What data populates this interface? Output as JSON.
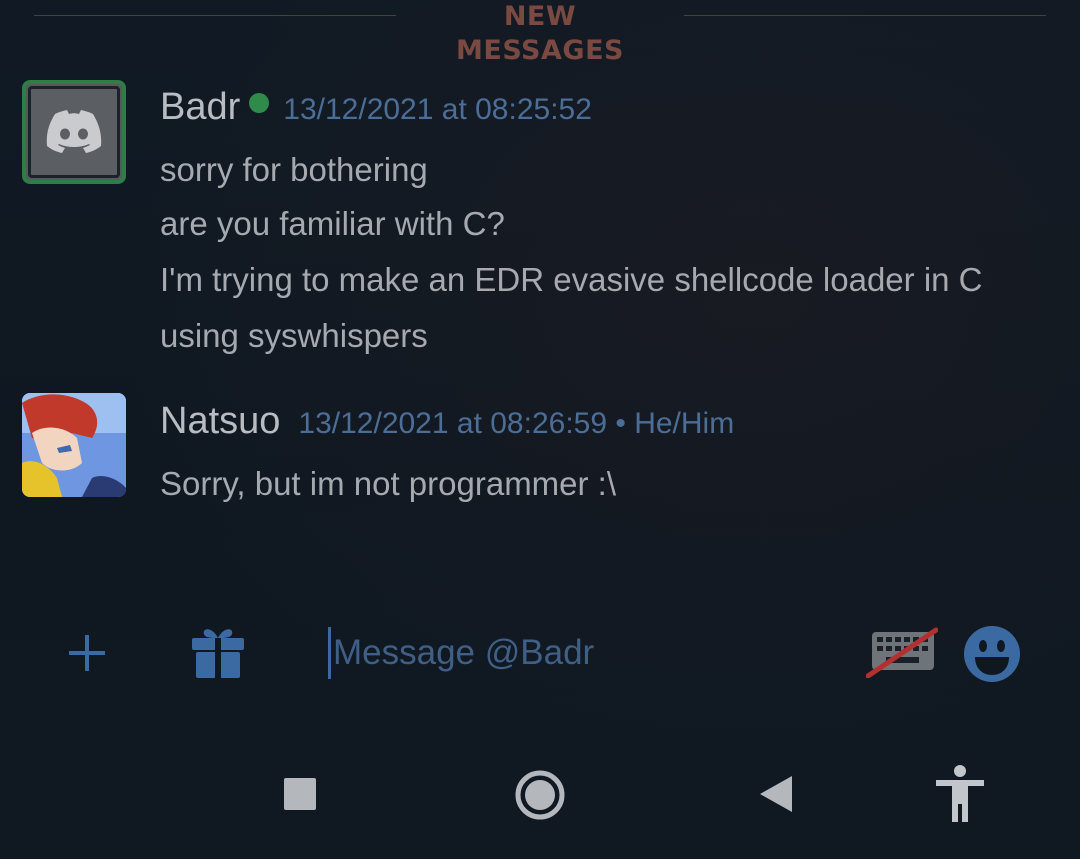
{
  "divider": {
    "label": "NEW MESSAGES"
  },
  "messages": [
    {
      "username": "Badr",
      "timestamp": "13/12/2021 at 08:25:52",
      "online": true,
      "lines": [
        "sorry for bothering",
        "are you familiar with C?",
        "I'm trying to make an EDR evasive shellcode loader in C",
        "using syswhispers"
      ]
    },
    {
      "username": "Natsuo",
      "timestamp": "13/12/2021 at 08:26:59 • He/Him",
      "lines": [
        "Sorry, but im not programmer :\\"
      ]
    }
  ],
  "input": {
    "placeholder": "Message @Badr"
  },
  "icons": {
    "add": "plus-icon",
    "gift": "gift-icon",
    "keyboard": "keyboard-disabled-icon",
    "emoji": "emoji-icon",
    "nav_recent": "square-icon",
    "nav_home": "circle-icon",
    "nav_back": "triangle-back-icon",
    "nav_accessibility": "accessibility-icon"
  },
  "colors": {
    "background": "#0f1720",
    "accent_blue": "#3b6aa3",
    "online_green": "#2e8b4a",
    "divider_red": "#7a4a42"
  }
}
